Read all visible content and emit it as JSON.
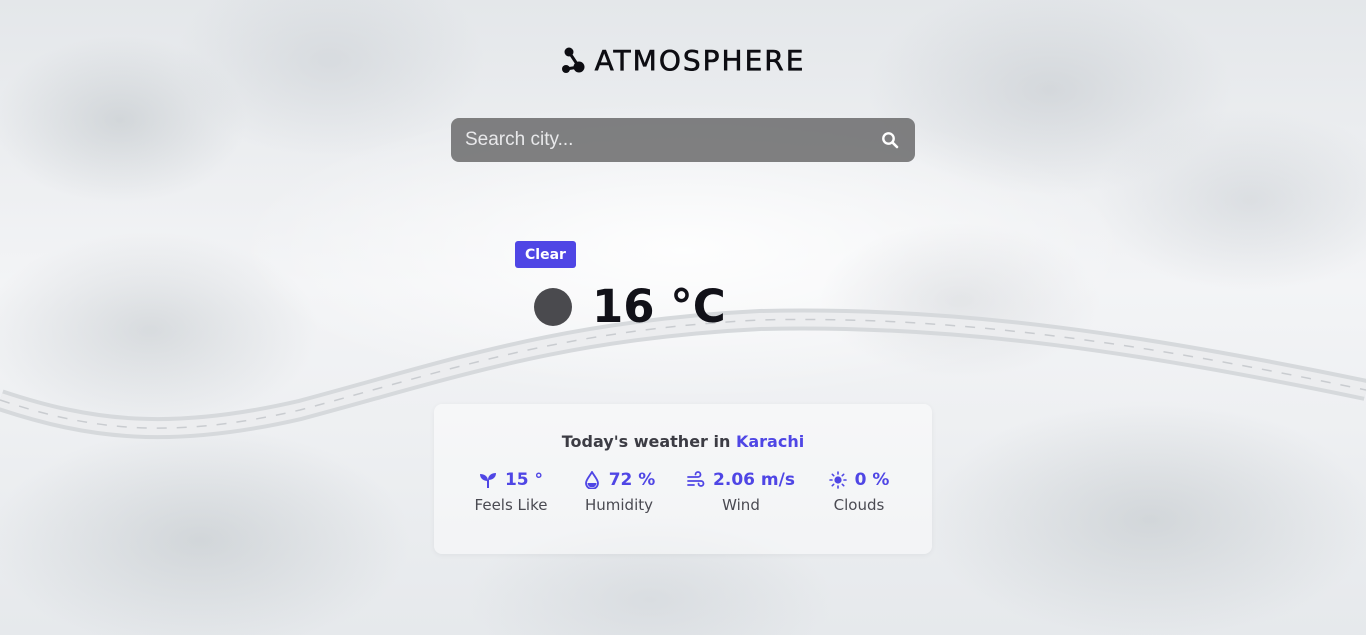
{
  "brand": {
    "name": "ATMOSPHERE",
    "logo_icon": "molecule-icon"
  },
  "search": {
    "placeholder": "Search city...",
    "value": "",
    "icon": "search-icon"
  },
  "current": {
    "condition": "Clear",
    "temperature": "16 °C",
    "icon": "weather-condition-icon"
  },
  "details": {
    "title_prefix": "Today's weather in",
    "city": "Karachi",
    "stats": [
      {
        "value": "15 °",
        "label": "Feels Like",
        "icon": "sprout-icon"
      },
      {
        "value": "72 %",
        "label": "Humidity",
        "icon": "droplet-icon"
      },
      {
        "value": "2.06 m/s",
        "label": "Wind",
        "icon": "wind-icon"
      },
      {
        "value": "0 %",
        "label": "Clouds",
        "icon": "sun-icon"
      }
    ]
  },
  "colors": {
    "accent": "#4f46e5",
    "search_bg": "#6e6e70",
    "text_dark": "#111118"
  }
}
